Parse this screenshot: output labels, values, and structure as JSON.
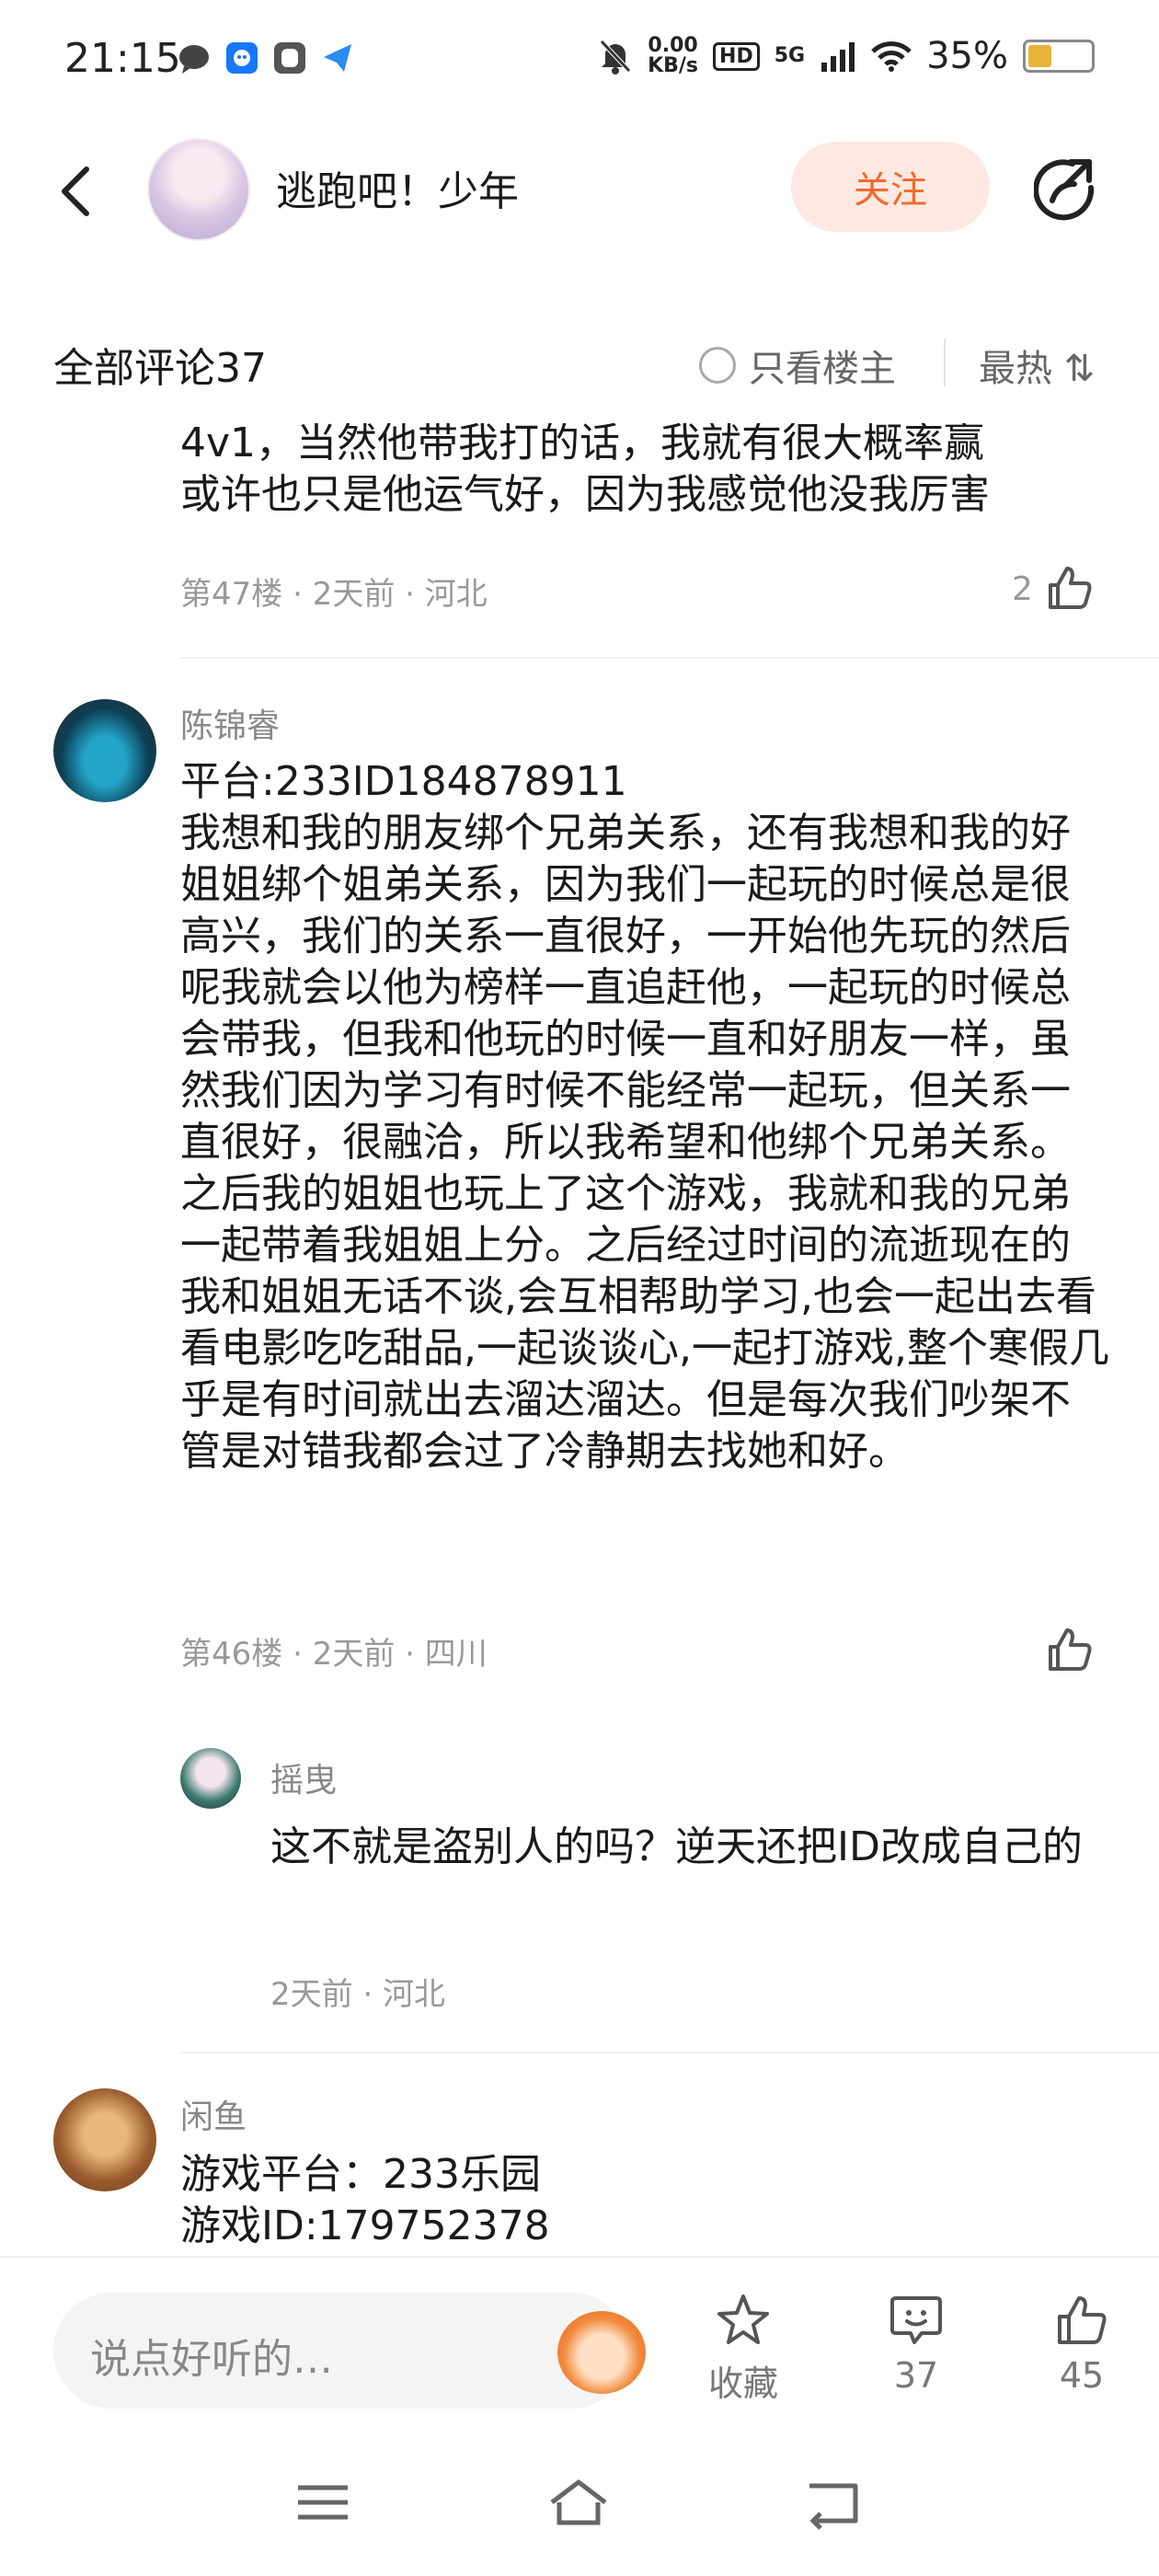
{
  "status_bar": {
    "time": "21:15",
    "net_speed_value": "0.00",
    "net_speed_unit": "KB/s",
    "hd_badge": "HD",
    "cellular": "5G",
    "battery_percent": "35%"
  },
  "header": {
    "title": "逃跑吧！少年",
    "follow_label": "关注"
  },
  "comment_bar": {
    "count_label": "全部评论37",
    "owner_only_label": "只看楼主",
    "sort_label": "最热 ⇅"
  },
  "comments": [
    {
      "text": "4v1，当然他带我打的话，我就有很大概率赢\n或许也只是他运气好，因为我感觉他没我厉害",
      "meta": "第47楼 · 2天前 · 河北",
      "likes": "2"
    },
    {
      "author": "陈锦睿",
      "text": "平台:233ID184878911\n我想和我的朋友绑个兄弟关系，还有我想和我的好姐姐绑个姐弟关系，因为我们一起玩的时候总是很高兴，我们的关系一直很好，一开始他先玩的然后呢我就会以他为榜样一直追赶他，一起玩的时候总会带我，但我和他玩的时候一直和好朋友一样，虽然我们因为学习有时候不能经常一起玩，但关系一直很好，很融洽，所以我希望和他绑个兄弟关系。之后我的姐姐也玩上了这个游戏，我就和我的兄弟一起带着我姐姐上分。之后经过时间的流逝现在的我和姐姐无话不谈,会互相帮助学习,也会一起出去看看电影吃吃甜品,一起谈谈心,一起打游戏,整个寒假几乎是有时间就出去溜达溜达。但是每次我们吵架不管是对错我都会过了冷静期去找她和好。",
      "meta": "第46楼 · 2天前 · 四川",
      "reply": {
        "author": "摇曳",
        "text": "这不就是盗别人的吗？逆天还把ID改成自己的",
        "meta": "2天前 · 河北"
      }
    },
    {
      "author": "闲鱼",
      "text": "游戏平台：233乐园\n游戏ID:179752378"
    }
  ],
  "bottom_bar": {
    "input_placeholder": "说点好听的…",
    "favorite_label": "收藏",
    "comment_count": "37",
    "like_count": "45"
  },
  "colors": {
    "accent": "#f06a2c",
    "follow_bg": "#fde9e1",
    "meta_text": "#999999"
  }
}
